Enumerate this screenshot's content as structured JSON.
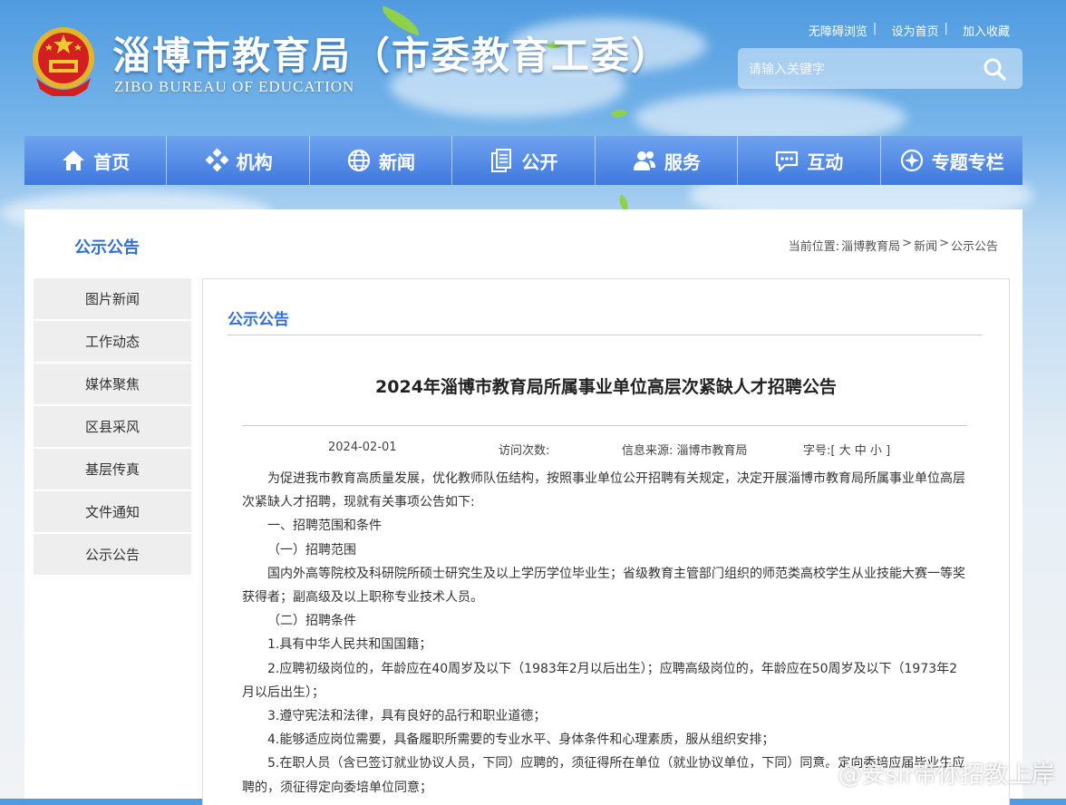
{
  "header": {
    "site_title": "淄博市教育局（市委教育工委）",
    "site_subtitle": "ZIBO BUREAU OF EDUCATION",
    "top_links": [
      "无障碍浏览",
      "设为首页",
      "加入收藏"
    ],
    "search_placeholder": "请输入关键字"
  },
  "nav": {
    "items": [
      {
        "label": "首页",
        "icon": "home-icon"
      },
      {
        "label": "机构",
        "icon": "org-icon"
      },
      {
        "label": "新闻",
        "icon": "globe-icon"
      },
      {
        "label": "公开",
        "icon": "document-icon"
      },
      {
        "label": "服务",
        "icon": "users-icon"
      },
      {
        "label": "互动",
        "icon": "chat-icon"
      },
      {
        "label": "专题专栏",
        "icon": "topics-icon"
      }
    ]
  },
  "section_title": "公示公告",
  "breadcrumb": {
    "prefix": "当前位置:",
    "items": [
      "淄博教育局",
      "新闻",
      "公示公告"
    ],
    "sep": ">"
  },
  "sidebar": {
    "items": [
      "图片新闻",
      "工作动态",
      "媒体聚焦",
      "区县采风",
      "基层传真",
      "文件通知",
      "公示公告"
    ]
  },
  "article": {
    "category": "公示公告",
    "title": "2024年淄博市教育局所属事业单位高层次紧缺人才招聘公告",
    "date": "2024-02-01",
    "visits_label": "访问次数:",
    "source_label": "信息来源:",
    "source_value": "淄博市教育局",
    "font_label": "字号:",
    "font_sizes": [
      "大",
      "中",
      "小"
    ],
    "paragraphs": [
      {
        "text": "为促进我市教育高质量发展，优化教师队伍结构，按照事业单位公开招聘有关规定，决定开展淄博市教育局所属事业单位高层次紧缺人才招聘，现就有关事项公告如下:",
        "indent": true
      },
      {
        "text": "一、招聘范围和条件",
        "indent": true
      },
      {
        "text": "（一）招聘范围",
        "indent": true
      },
      {
        "text": "国内外高等院校及科研院所硕士研究生及以上学历学位毕业生；省级教育主管部门组织的师范类高校学生从业技能大赛一等奖获得者；副高级及以上职称专业技术人员。",
        "indent": true
      },
      {
        "text": "（二）招聘条件",
        "indent": true
      },
      {
        "text": "1.具有中华人民共和国国籍；",
        "indent": true
      },
      {
        "text": "2.应聘初级岗位的，年龄应在40周岁及以下（1983年2月以后出生）；应聘高级岗位的，年龄应在50周岁及以下（1973年2月以后出生）；",
        "indent": true
      },
      {
        "text": "3.遵守宪法和法律，具有良好的品行和职业道德；",
        "indent": true
      },
      {
        "text": "4.能够适应岗位需要，具备履职所需要的专业水平、身体条件和心理素质，服从组织安排；",
        "indent": true
      },
      {
        "text": "5.在职人员（含已签订就业协议人员，下同）应聘的，须征得所在单位（就业协议单位，下同）同意。定向委培应届毕业生应聘的，须征得定向委培单位同意；",
        "indent": true
      }
    ]
  },
  "watermark": "@安sir带你招教上岸",
  "colors": {
    "nav": "#4a82e3",
    "accent": "#2f6fd6",
    "sidebar_bg": "#eeeeee"
  }
}
